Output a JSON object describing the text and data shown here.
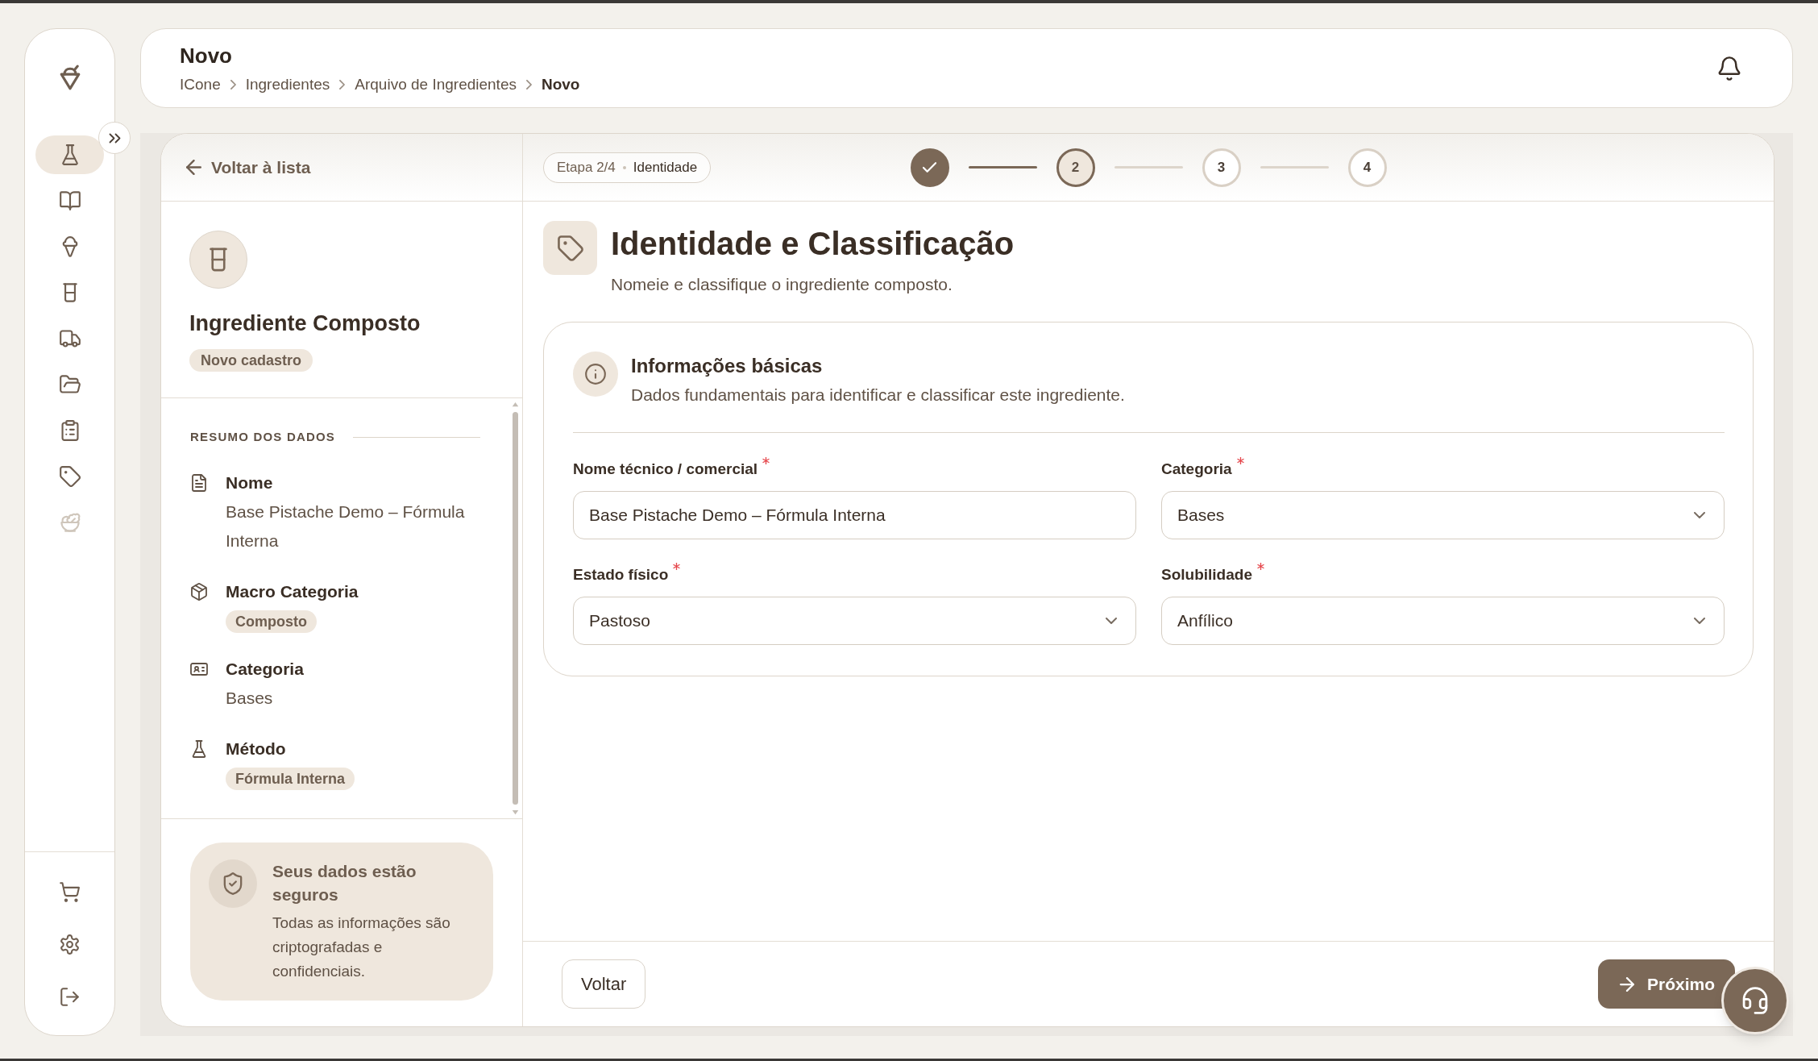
{
  "sidebar": {
    "nav_items": [
      {
        "selected": true,
        "disabled": false
      },
      {
        "selected": false,
        "disabled": false
      },
      {
        "selected": false,
        "disabled": false
      },
      {
        "selected": false,
        "disabled": false
      },
      {
        "selected": false,
        "disabled": false
      },
      {
        "selected": false,
        "disabled": false
      },
      {
        "selected": false,
        "disabled": false
      },
      {
        "selected": false,
        "disabled": false
      },
      {
        "selected": false,
        "disabled": true
      }
    ]
  },
  "header": {
    "title": "Novo",
    "breadcrumb": [
      {
        "label": "ICone",
        "current": false
      },
      {
        "label": "Ingredientes",
        "current": false
      },
      {
        "label": "Arquivo de Ingredientes",
        "current": false
      },
      {
        "label": "Novo",
        "current": true
      }
    ]
  },
  "summary_panel": {
    "back_link": "Voltar à lista",
    "title": "Ingrediente Composto",
    "badge": "Novo cadastro",
    "heading": "RESUMO DOS DADOS",
    "items": [
      {
        "kind": "text",
        "label": "Nome",
        "value": "Base Pistache Demo – Fórmula Interna"
      },
      {
        "kind": "badge",
        "label": "Macro Categoria",
        "value": "Composto"
      },
      {
        "kind": "text",
        "label": "Categoria",
        "value": "Bases"
      },
      {
        "kind": "badge",
        "label": "Método",
        "value": "Fórmula Interna"
      }
    ],
    "security_note": {
      "title": "Seus dados estão seguros",
      "text": "Todas as informações são criptografadas e confidenciais."
    }
  },
  "wizard": {
    "step_badge": {
      "step": "Etapa 2/4",
      "name": "Identidade"
    },
    "steps": [
      {
        "completed": true,
        "selected": false
      },
      {
        "label": "2",
        "completed": false,
        "selected": true
      },
      {
        "label": "3",
        "completed": false,
        "selected": false
      },
      {
        "label": "4",
        "completed": false,
        "selected": false
      }
    ],
    "section": {
      "title": "Identidade e Classificação",
      "subtitle": "Nomeie e classifique o ingrediente composto."
    },
    "form_card": {
      "title": "Informações básicas",
      "description": "Dados fundamentais para identificar e classificar este ingrediente.",
      "fields": [
        {
          "kind": "text",
          "label": "Nome técnico / comercial",
          "required": true,
          "value": "Base Pistache Demo – Fórmula Interna"
        },
        {
          "kind": "select",
          "label": "Categoria",
          "required": true,
          "value": "Bases"
        },
        {
          "kind": "select",
          "label": "Estado físico",
          "required": true,
          "value": "Pastoso"
        },
        {
          "kind": "select",
          "label": "Solubilidade",
          "required": true,
          "value": "Anfílico"
        }
      ]
    },
    "footer": {
      "back_button": "Voltar",
      "next_button": "Próximo"
    }
  }
}
